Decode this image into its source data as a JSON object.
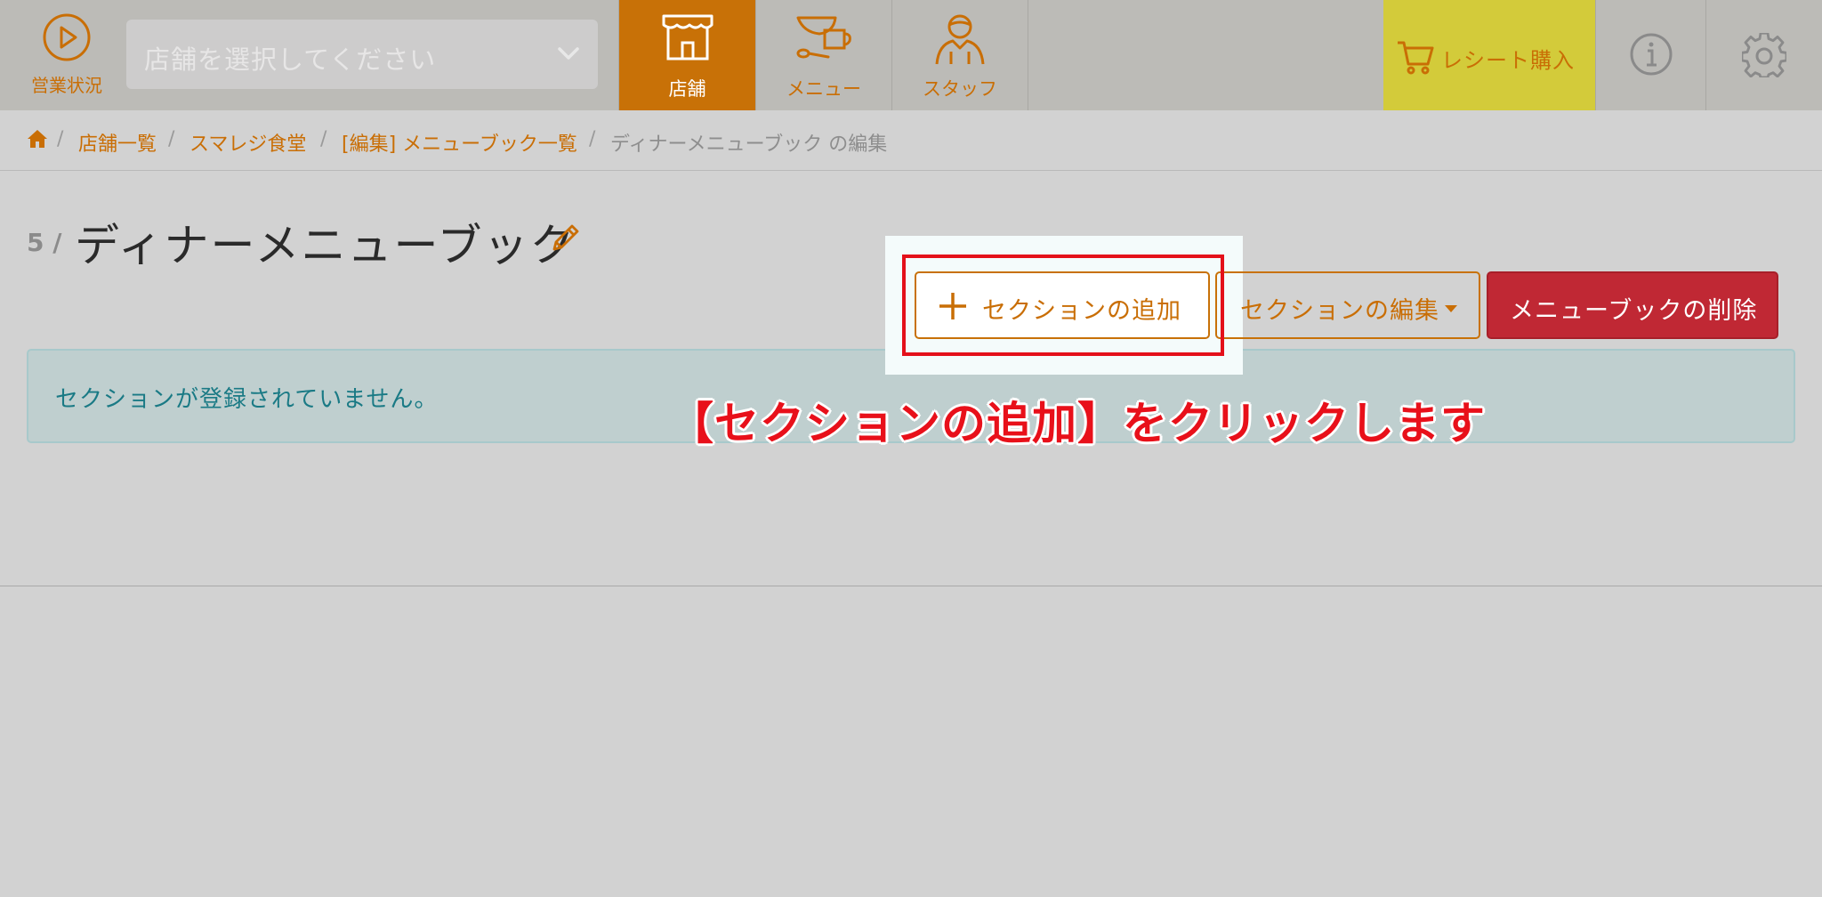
{
  "navbar": {
    "status_label": "営業状況",
    "store_select_placeholder": "店舗を選択してください",
    "tabs": [
      {
        "label": "店舗",
        "active": true
      },
      {
        "label": "メニュー",
        "active": false
      },
      {
        "label": "スタッフ",
        "active": false
      }
    ],
    "receipt_label": "レシート購入"
  },
  "breadcrumb": {
    "items": [
      "店舗一覧",
      "スマレジ食堂",
      "[編集] メニューブック一覧"
    ],
    "current": "ディナーメニューブック の編集",
    "separator": "/"
  },
  "page": {
    "number": "5 /",
    "title": "ディナーメニューブック"
  },
  "actions": {
    "add_section": "セクションの追加",
    "edit_section": "セクションの編集",
    "delete_menubook": "メニューブックの削除"
  },
  "alert": {
    "message": "セクションが登録されていません。"
  },
  "annotation": "【セクションの追加】をクリックします",
  "colors": {
    "accent": "#c87107",
    "danger": "#c02834",
    "highlight": "#e4101a",
    "receipt_bg": "#d3cb3a"
  }
}
